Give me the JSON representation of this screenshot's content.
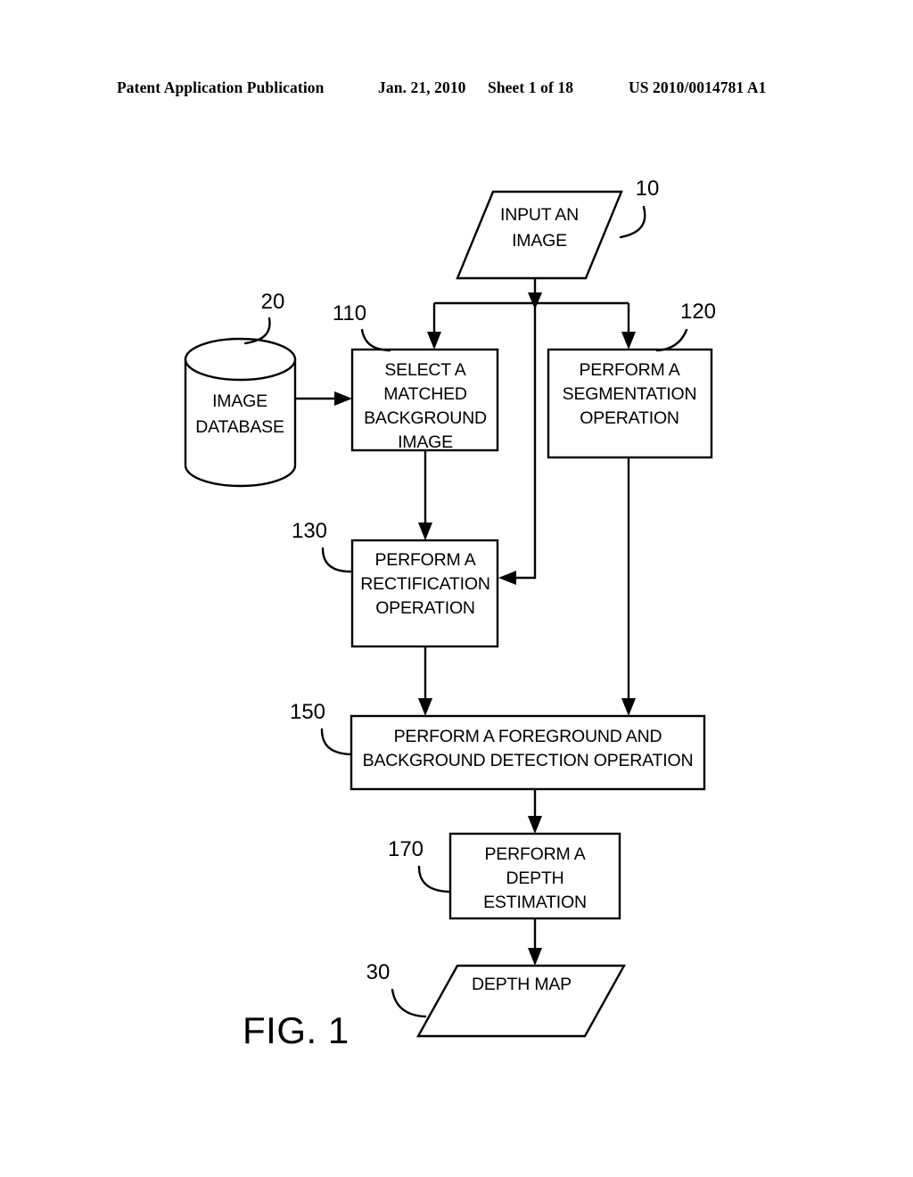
{
  "header": {
    "publication": "Patent Application Publication",
    "date": "Jan. 21, 2010",
    "sheet": "Sheet 1 of 18",
    "patent_number": "US 2010/0014781 A1"
  },
  "figure": {
    "caption": "FIG. 1",
    "nodes": {
      "input_image": {
        "ref": "10",
        "line1": "INPUT AN",
        "line2": "IMAGE",
        "shape": "parallelogram"
      },
      "image_database": {
        "ref": "20",
        "line1": "IMAGE",
        "line2": "DATABASE",
        "shape": "cylinder"
      },
      "select_background": {
        "ref": "110",
        "line1": "SELECT A",
        "line2": "MATCHED",
        "line3": "BACKGROUND",
        "line4": "IMAGE",
        "shape": "rectangle"
      },
      "segmentation": {
        "ref": "120",
        "line1": "PERFORM A",
        "line2": "SEGMENTATION",
        "line3": "OPERATION",
        "shape": "rectangle"
      },
      "rectification": {
        "ref": "130",
        "line1": "PERFORM A",
        "line2": "RECTIFICATION",
        "line3": "OPERATION",
        "shape": "rectangle"
      },
      "detection": {
        "ref": "150",
        "line1": "PERFORM A FOREGROUND AND",
        "line2": "BACKGROUND DETECTION OPERATION",
        "shape": "rectangle"
      },
      "depth_estimation": {
        "ref": "170",
        "line1": "PERFORM A",
        "line2": "DEPTH",
        "line3": "ESTIMATION",
        "shape": "rectangle"
      },
      "depth_map": {
        "ref": "30",
        "line1": "DEPTH MAP",
        "shape": "parallelogram"
      }
    }
  },
  "colors": {
    "ink": "#000000",
    "paper": "#ffffff"
  }
}
